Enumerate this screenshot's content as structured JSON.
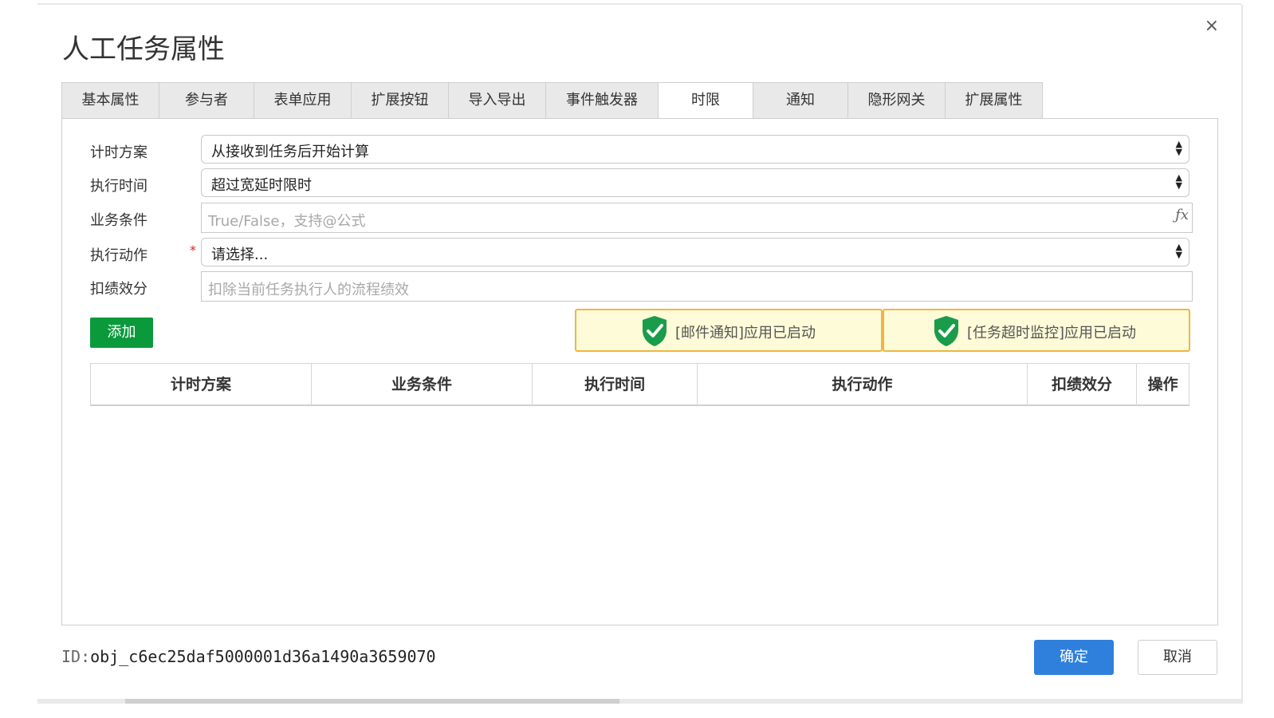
{
  "dialog": {
    "title": "人工任务属性",
    "close_glyph": "×"
  },
  "tabs": [
    {
      "label": "基本属性",
      "active": false
    },
    {
      "label": "参与者",
      "active": false
    },
    {
      "label": "表单应用",
      "active": false
    },
    {
      "label": "扩展按钮",
      "active": false
    },
    {
      "label": "导入导出",
      "active": false
    },
    {
      "label": "事件触发器",
      "active": false
    },
    {
      "label": "时限",
      "active": true
    },
    {
      "label": "通知",
      "active": false
    },
    {
      "label": "隐形网关",
      "active": false
    },
    {
      "label": "扩展属性",
      "active": false
    }
  ],
  "form": {
    "timing_scheme": {
      "label": "计时方案",
      "value": "从接收到任务后开始计算"
    },
    "exec_time": {
      "label": "执行时间",
      "value": "超过宽延时限时"
    },
    "business_condition": {
      "label": "业务条件",
      "placeholder": "True/False，支持@公式",
      "fx_icon": "ƒx"
    },
    "exec_action": {
      "label": "执行动作",
      "required_mark": "*",
      "value": "请选择..."
    },
    "deduct_score": {
      "label": "扣绩效分",
      "placeholder": "扣除当前任务执行人的流程绩效"
    }
  },
  "add_button": "添加",
  "notices": [
    {
      "text": "[邮件通知]应用已启动",
      "icon": "shield-check-icon"
    },
    {
      "text": "[任务超时监控]应用已启动",
      "icon": "shield-check-icon"
    }
  ],
  "table": {
    "headers": [
      "计时方案",
      "业务条件",
      "执行时间",
      "执行动作",
      "扣绩效分",
      "操作"
    ],
    "rows": []
  },
  "footer": {
    "id_label": "ID:",
    "id_value": "obj_c6ec25daf5000001d36a1490a3659070",
    "ok_button": "确定",
    "cancel_button": "取消"
  },
  "colors": {
    "accent_green": "#0a9a3c",
    "primary_blue": "#2e80dc",
    "notice_bg": "#fdfbd8",
    "notice_border": "#f0b545",
    "shield_green": "#1a9c4a"
  }
}
